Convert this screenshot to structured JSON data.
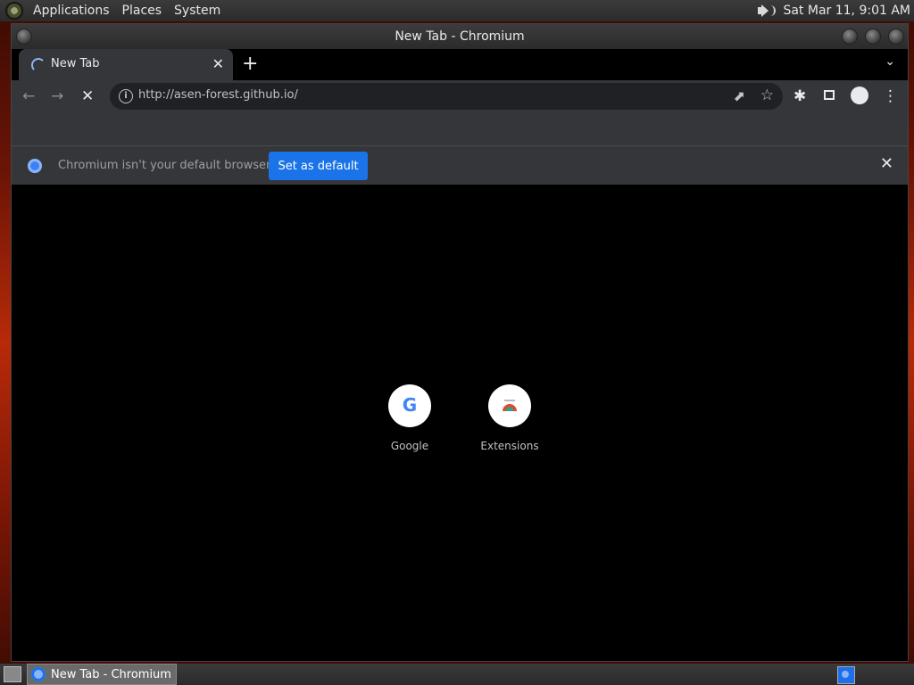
{
  "top_panel": {
    "menus": [
      "Applications",
      "Places",
      "System"
    ],
    "clock": "Sat Mar 11,  9:01 AM"
  },
  "window": {
    "title": "New Tab - Chromium"
  },
  "tab": {
    "title": "New Tab",
    "close": "✕",
    "new_tab": "+",
    "menu": "⌄"
  },
  "toolbar": {
    "back": "←",
    "forward": "→",
    "stop": "✕",
    "url": "http://asen-forest.github.io/",
    "extensions": "✱",
    "menu": "⋮"
  },
  "infobar": {
    "message": "Chromium isn't your default browser",
    "button": "Set as default",
    "close": "✕"
  },
  "shortcuts": [
    {
      "label": "Google",
      "glyph": "G"
    },
    {
      "label": "Extensions"
    }
  ],
  "taskbar": {
    "item": "New Tab - Chromium"
  },
  "colors": {
    "accent": "#1a73e8",
    "content_bg": "#000000",
    "toolbar_bg": "#343639"
  }
}
